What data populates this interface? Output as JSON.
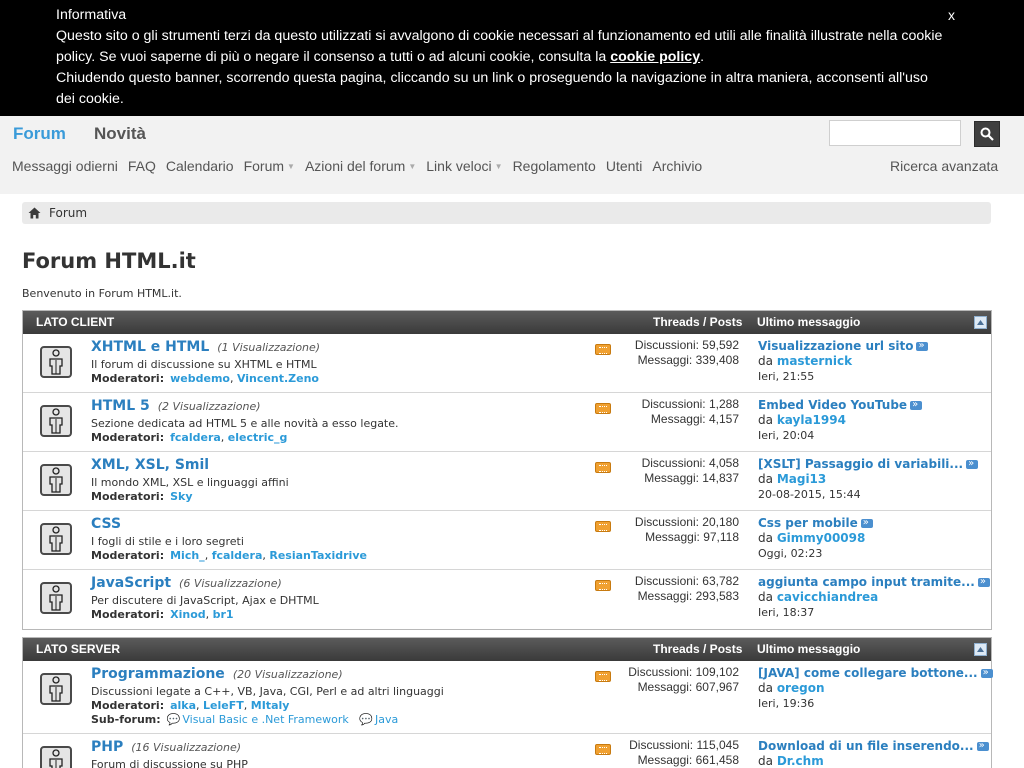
{
  "cookie_banner": {
    "title": "Informativa",
    "text1": "Questo sito o gli strumenti terzi da questo utilizzati si avvalgono di cookie necessari al funzionamento ed utili alle finalità illustrate nella cookie policy. Se vuoi saperne di più o negare il consenso a tutti o ad alcuni cookie, consulta la",
    "link": "cookie policy",
    "after_link": ".",
    "text2": "Chiudendo questo banner, scorrendo questa pagina, cliccando su un link o proseguendo la navigazione in altra maniera, acconsenti all'uso dei cookie.",
    "close": "x"
  },
  "header": {
    "tabs": [
      "Forum",
      "Novità"
    ],
    "nav": [
      "Messaggi odierni",
      "FAQ",
      "Calendario",
      "Forum",
      "Azioni del forum",
      "Link veloci",
      "Regolamento",
      "Utenti",
      "Archivio"
    ],
    "advanced_search": "Ricerca avanzata",
    "search_value": ""
  },
  "breadcrumb": {
    "item": "Forum"
  },
  "page": {
    "title": "Forum HTML.it",
    "welcome": "Benvenuto in Forum HTML.it."
  },
  "labels": {
    "threads_posts": "Threads / Posts",
    "last_message": "Ultimo messaggio",
    "moderators": "Moderatori:",
    "subforum": "Sub-forum:",
    "discussions": "Discussioni:",
    "messages": "Messaggi:",
    "by": "da"
  },
  "categories": [
    {
      "name": "LATO CLIENT",
      "forums": [
        {
          "name": "XHTML e HTML",
          "views": "(1 Visualizzazione)",
          "desc": "Il forum di discussione su XHTML e HTML",
          "mods": [
            "webdemo",
            "Vincent.Zeno"
          ],
          "discussions": "59,592",
          "messages": "339,408",
          "last_title": "Visualizzazione url sito",
          "last_user": "masternick",
          "last_date": "Ieri, 21:55"
        },
        {
          "name": "HTML 5",
          "views": "(2 Visualizzazione)",
          "desc": "Sezione dedicata ad HTML 5 e alle novità a esso legate.",
          "mods": [
            "fcaldera",
            "electric_g"
          ],
          "discussions": "1,288",
          "messages": "4,157",
          "last_title": "Embed Video YouTube",
          "last_user": "kayla1994",
          "last_date": "Ieri, 20:04"
        },
        {
          "name": "XML, XSL, Smil",
          "views": "",
          "desc": "Il mondo XML, XSL e linguaggi affini",
          "mods": [
            "Sky"
          ],
          "discussions": "4,058",
          "messages": "14,837",
          "last_title": "[XSLT] Passaggio di variabili...",
          "last_user": "Magi13",
          "last_date": "20-08-2015, 15:44"
        },
        {
          "name": "CSS",
          "views": "",
          "desc": "I fogli di stile e i loro segreti",
          "mods": [
            "Mich_",
            "fcaldera",
            "ResianTaxidrive"
          ],
          "discussions": "20,180",
          "messages": "97,118",
          "last_title": "Css per mobile",
          "last_user": "Gimmy00098",
          "last_date": "Oggi, 02:23"
        },
        {
          "name": "JavaScript",
          "views": "(6 Visualizzazione)",
          "desc": "Per discutere di JavaScript, Ajax e DHTML",
          "mods": [
            "Xinod",
            "br1"
          ],
          "discussions": "63,782",
          "messages": "293,583",
          "last_title": "aggiunta campo input tramite...",
          "last_user": "cavicchiandrea",
          "last_date": "Ieri, 18:37"
        }
      ]
    },
    {
      "name": "LATO SERVER",
      "forums": [
        {
          "name": "Programmazione",
          "views": "(20 Visualizzazione)",
          "desc": "Discussioni legate a C++, VB, Java, CGI, Perl e ad altri linguaggi",
          "mods": [
            "alka",
            "LeleFT",
            "MItaly"
          ],
          "subforums": [
            "Visual Basic e .Net Framework",
            "Java"
          ],
          "discussions": "109,102",
          "messages": "607,967",
          "last_title": "[JAVA] come collegare bottone...",
          "last_user": "oregon",
          "last_date": "Ieri, 19:36"
        },
        {
          "name": "PHP",
          "views": "(16 Visualizzazione)",
          "desc": "Forum di discussione su PHP",
          "mods": [],
          "discussions": "115,045",
          "messages": "661,458",
          "last_title": "Download di un file inserendo...",
          "last_user": "Dr.chm",
          "last_date": ""
        }
      ]
    }
  ]
}
